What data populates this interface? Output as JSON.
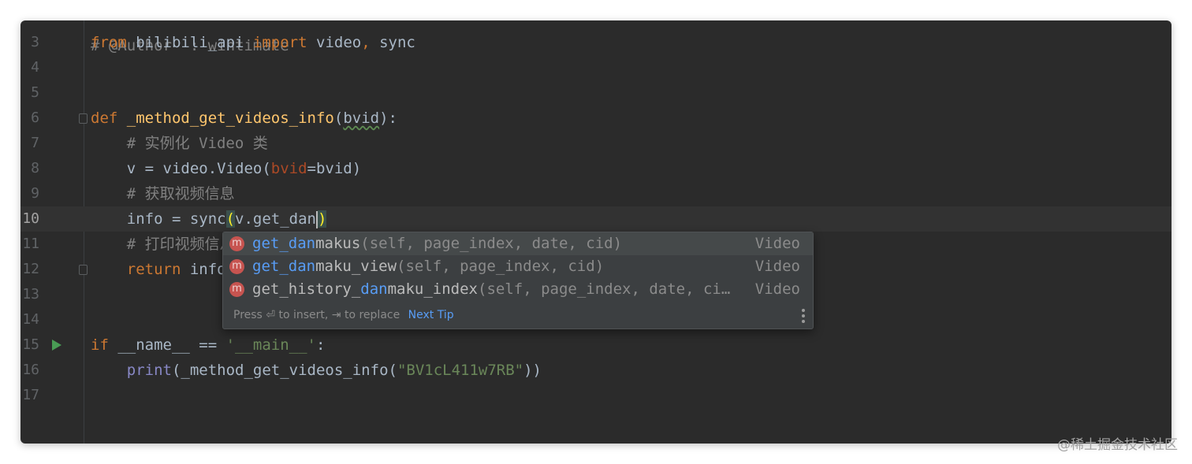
{
  "editor": {
    "top_partial": "# @Author  : wintimate",
    "lines": [
      {
        "n": "3",
        "parts": [
          [
            "kw",
            "from"
          ],
          [
            "t",
            " bilibili_api "
          ],
          [
            "kw",
            "import"
          ],
          [
            "t",
            " video"
          ],
          [
            "kw",
            ","
          ],
          [
            "t",
            " sync"
          ]
        ]
      },
      {
        "n": "4",
        "parts": []
      },
      {
        "n": "5",
        "parts": []
      },
      {
        "n": "6",
        "parts": [
          [
            "kw",
            "def "
          ],
          [
            "fn",
            "_method_get_videos_info"
          ],
          [
            "t",
            "("
          ],
          [
            "sq",
            "bvid"
          ],
          [
            "t",
            "):"
          ]
        ]
      },
      {
        "n": "7",
        "parts": [
          [
            "t",
            "    "
          ],
          [
            "cm",
            "# 实例化 Video 类"
          ]
        ]
      },
      {
        "n": "8",
        "parts": [
          [
            "t",
            "    v = video.Video("
          ],
          [
            "param",
            "bvid"
          ],
          [
            "t",
            "=bvid)"
          ]
        ]
      },
      {
        "n": "9",
        "parts": [
          [
            "t",
            "    "
          ],
          [
            "cm",
            "# 获取视频信息"
          ]
        ]
      },
      {
        "n": "10",
        "current": true,
        "parts": [
          [
            "t",
            "    info = sync"
          ],
          [
            "bh",
            "("
          ],
          [
            "t",
            "v.get_dan"
          ],
          [
            "caret",
            ""
          ],
          [
            "bh",
            ")"
          ]
        ]
      },
      {
        "n": "11",
        "parts": [
          [
            "t",
            "    "
          ],
          [
            "cm",
            "# 打印视频信息"
          ]
        ]
      },
      {
        "n": "12",
        "parts": [
          [
            "t",
            "    "
          ],
          [
            "kw",
            "return"
          ],
          [
            "t",
            " info"
          ]
        ]
      },
      {
        "n": "13",
        "parts": []
      },
      {
        "n": "14",
        "parts": []
      },
      {
        "n": "15",
        "parts": [
          [
            "kw",
            "if"
          ],
          [
            "t",
            " __name__ == "
          ],
          [
            "str",
            "'__main__'"
          ],
          [
            "t",
            ":"
          ]
        ]
      },
      {
        "n": "16",
        "parts": [
          [
            "t",
            "    "
          ],
          [
            "bi",
            "print"
          ],
          [
            "t",
            "(_method_get_videos_info("
          ],
          [
            "str",
            "\"BV1cL411w7RB\""
          ],
          [
            "t",
            "))"
          ]
        ]
      },
      {
        "n": "17",
        "parts": []
      }
    ]
  },
  "completion": {
    "items": [
      {
        "icon": "m",
        "match": "get_dan",
        "rest": "makus",
        "sig": "(self, page_index, date, cid)",
        "tail": "Video",
        "selected": true
      },
      {
        "icon": "m",
        "match": "get_dan",
        "rest": "maku_view",
        "sig": "(self, page_index, cid)",
        "tail": "Video",
        "selected": false
      },
      {
        "icon": "m",
        "pre": "get_history_",
        "match": "dan",
        "rest": "maku_index",
        "sig": "(self, page_index, date, ci…",
        "tail": "Video",
        "selected": false
      }
    ],
    "footer_hint": "Press ⏎ to insert, ⇥ to replace",
    "footer_link": "Next Tip"
  },
  "watermark": "@稀土掘金技术社区",
  "colors": {
    "background": "#2b2b2b",
    "keyword": "#cc7832",
    "function": "#ffc66d",
    "comment": "#808080",
    "string": "#6a8759",
    "match": "#589df6"
  }
}
